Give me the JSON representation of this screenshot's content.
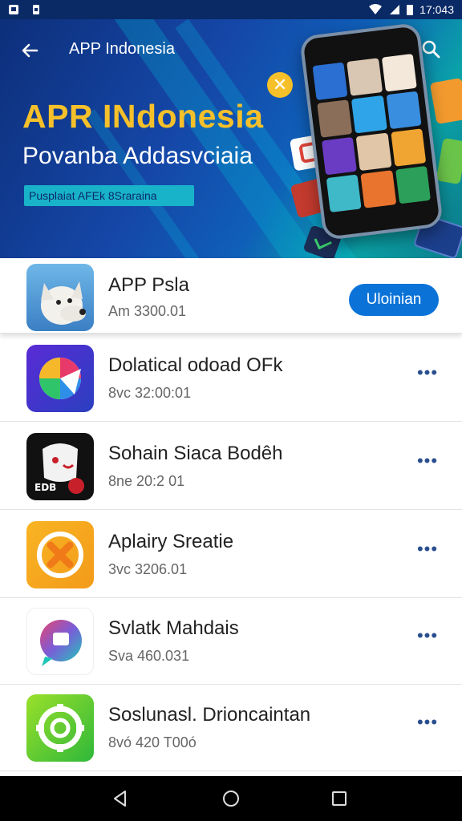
{
  "status_bar": {
    "time": "17:043",
    "icons": [
      "notification-icon",
      "sim-icon",
      "wifi-icon",
      "signal-icon",
      "battery-icon"
    ]
  },
  "header": {
    "title": "APP Indonesia",
    "back_icon": "arrow-left-icon",
    "search_icon": "search-icon"
  },
  "banner": {
    "title": "APR INdonesia",
    "subtitle": "Povanba Addasvciaia",
    "tag": "Pusplaiat AFEk 8Sraraina",
    "colors": {
      "title": "#f5c02a",
      "tag_bg": "#19b3c9"
    }
  },
  "featured_app": {
    "name": "APP Psla",
    "meta": "Am   3300.01",
    "install_label": "Uloinian",
    "icon": "dog-icon"
  },
  "apps": [
    {
      "name": "Dolatical odoad OFk",
      "meta": "8vc   32:00:01",
      "icon": "color-wheel-app-icon"
    },
    {
      "name": "Sohain Siaca Bodêh",
      "meta": "8ne   20:2 01",
      "icon": "ghost-app-icon"
    },
    {
      "name": "Aplairy Sreatie",
      "meta": "3vc   3206.01",
      "icon": "x-app-icon"
    },
    {
      "name": "Svlatk Mahdais",
      "meta": "Sva   460.031",
      "icon": "chat-app-icon"
    },
    {
      "name": "Soslunasl. Drioncaintan",
      "meta": "8vó   420 T00ó",
      "icon": "camera-app-icon"
    }
  ],
  "nav": {
    "icons": [
      "back-triangle-icon",
      "home-circle-icon",
      "recents-square-icon"
    ]
  }
}
